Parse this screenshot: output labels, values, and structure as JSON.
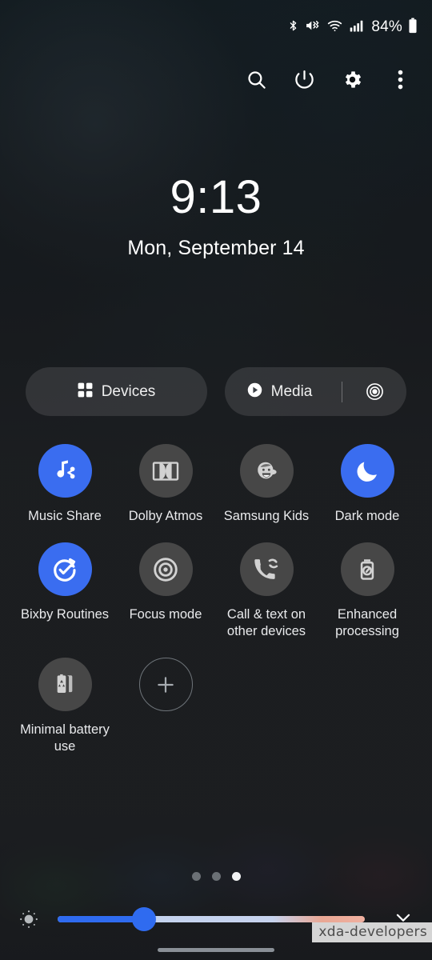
{
  "status_bar": {
    "icons": [
      "bluetooth-icon",
      "vibrate-icon",
      "wifi-icon",
      "signal-icon"
    ],
    "battery_text": "84%",
    "battery_icon": "battery-icon"
  },
  "toolbar": {
    "buttons": [
      {
        "name": "search-button",
        "icon": "search-icon"
      },
      {
        "name": "power-button",
        "icon": "power-icon"
      },
      {
        "name": "settings-button",
        "icon": "gear-icon"
      },
      {
        "name": "more-options-button",
        "icon": "more-vertical-icon"
      }
    ]
  },
  "clock": {
    "time": "9:13",
    "date": "Mon, September 14"
  },
  "pills": {
    "devices": {
      "label": "Devices",
      "icon": "grid-squares-icon"
    },
    "media": {
      "label": "Media",
      "icon": "play-circle-icon",
      "output_icon": "media-output-icon"
    }
  },
  "tiles": [
    {
      "label": "Music Share",
      "icon": "music-share-icon",
      "state": "on"
    },
    {
      "label": "Dolby Atmos",
      "icon": "dolby-atmos-icon",
      "state": "off"
    },
    {
      "label": "Samsung Kids",
      "icon": "samsung-kids-icon",
      "state": "off"
    },
    {
      "label": "Dark mode",
      "icon": "moon-icon",
      "state": "on"
    },
    {
      "label": "Bixby Routines",
      "icon": "bixby-routines-icon",
      "state": "on"
    },
    {
      "label": "Focus mode",
      "icon": "focus-target-icon",
      "state": "off"
    },
    {
      "label": "Call & text on other devices",
      "icon": "call-sync-icon",
      "state": "off"
    },
    {
      "label": "Enhanced processing",
      "icon": "enhanced-processing-icon",
      "state": "off"
    },
    {
      "label": "Minimal battery use",
      "icon": "minimal-battery-icon",
      "state": "off"
    },
    {
      "label": "",
      "icon": "add-plus-icon",
      "state": "ghost"
    }
  ],
  "pager": {
    "count": 3,
    "active_index": 2
  },
  "brightness": {
    "icon": "brightness-sun-icon",
    "value_percent": 28,
    "expand_icon": "chevron-down-icon"
  },
  "watermark": {
    "text": "xda-developers"
  },
  "nav_bar": {
    "handle": "gesture-handle"
  },
  "colors": {
    "accent_blue": "#3a6df0",
    "tile_off": "#474747",
    "panel_bg": "#1c1e21",
    "text_primary": "#ffffff"
  }
}
